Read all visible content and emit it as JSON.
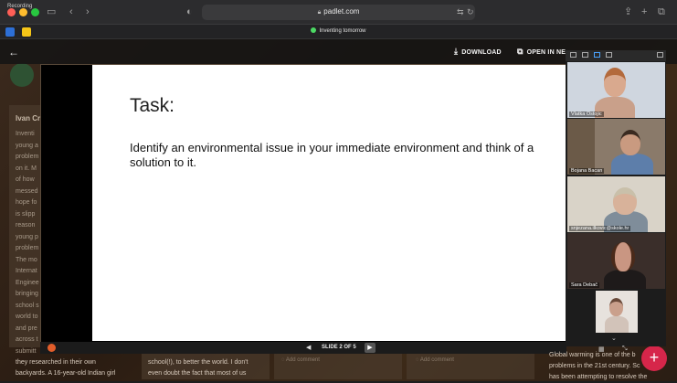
{
  "browser": {
    "recording_label": "Recording",
    "url": "padlet.com",
    "tab_title": "Inventing tomorrow"
  },
  "lightbox": {
    "download_label": "DOWNLOAD",
    "open_new_label": "OPEN IN NE",
    "slide": {
      "title": "Task:",
      "body": "Identify an environmental issue in your immediate environment and think of a solution to it."
    },
    "slide_counter": "SLIDE 2 OF 5"
  },
  "padlet": {
    "author_partial": "Ivan Cr",
    "left_column_lines": [
      "Inventi",
      "young a",
      "problem",
      "on it. M",
      "of how",
      "messed",
      "hope fo",
      "is slipp",
      "reason",
      "young p",
      "problem",
      "The mo",
      "Internat",
      "Enginee",
      "bringing",
      "school s",
      "world to",
      "and pre",
      "across t",
      "submitt"
    ],
    "bottom_col1": [
      "they researched in their own",
      "backyards. A 16-year-old Indian girl"
    ],
    "bottom_col2": [
      "school(!), to better the world. I don't",
      "even doubt the fact that most of us"
    ],
    "bottom_col3": [
      "Global warming is one of the b",
      "problems in the 21st century. Sc",
      "has been attempting to resolve the"
    ],
    "add_comment": "Add comment",
    "fab_label": "+"
  },
  "video_call": {
    "participants": [
      {
        "name": "Vlatka Ostojic"
      },
      {
        "name": "Bojana Bacan"
      },
      {
        "name": "snjezana.ilkovic@skole.hr"
      },
      {
        "name": "Sara Debač"
      },
      {
        "name": ""
      }
    ],
    "colors": {
      "accent_red": "#d6264a"
    }
  }
}
